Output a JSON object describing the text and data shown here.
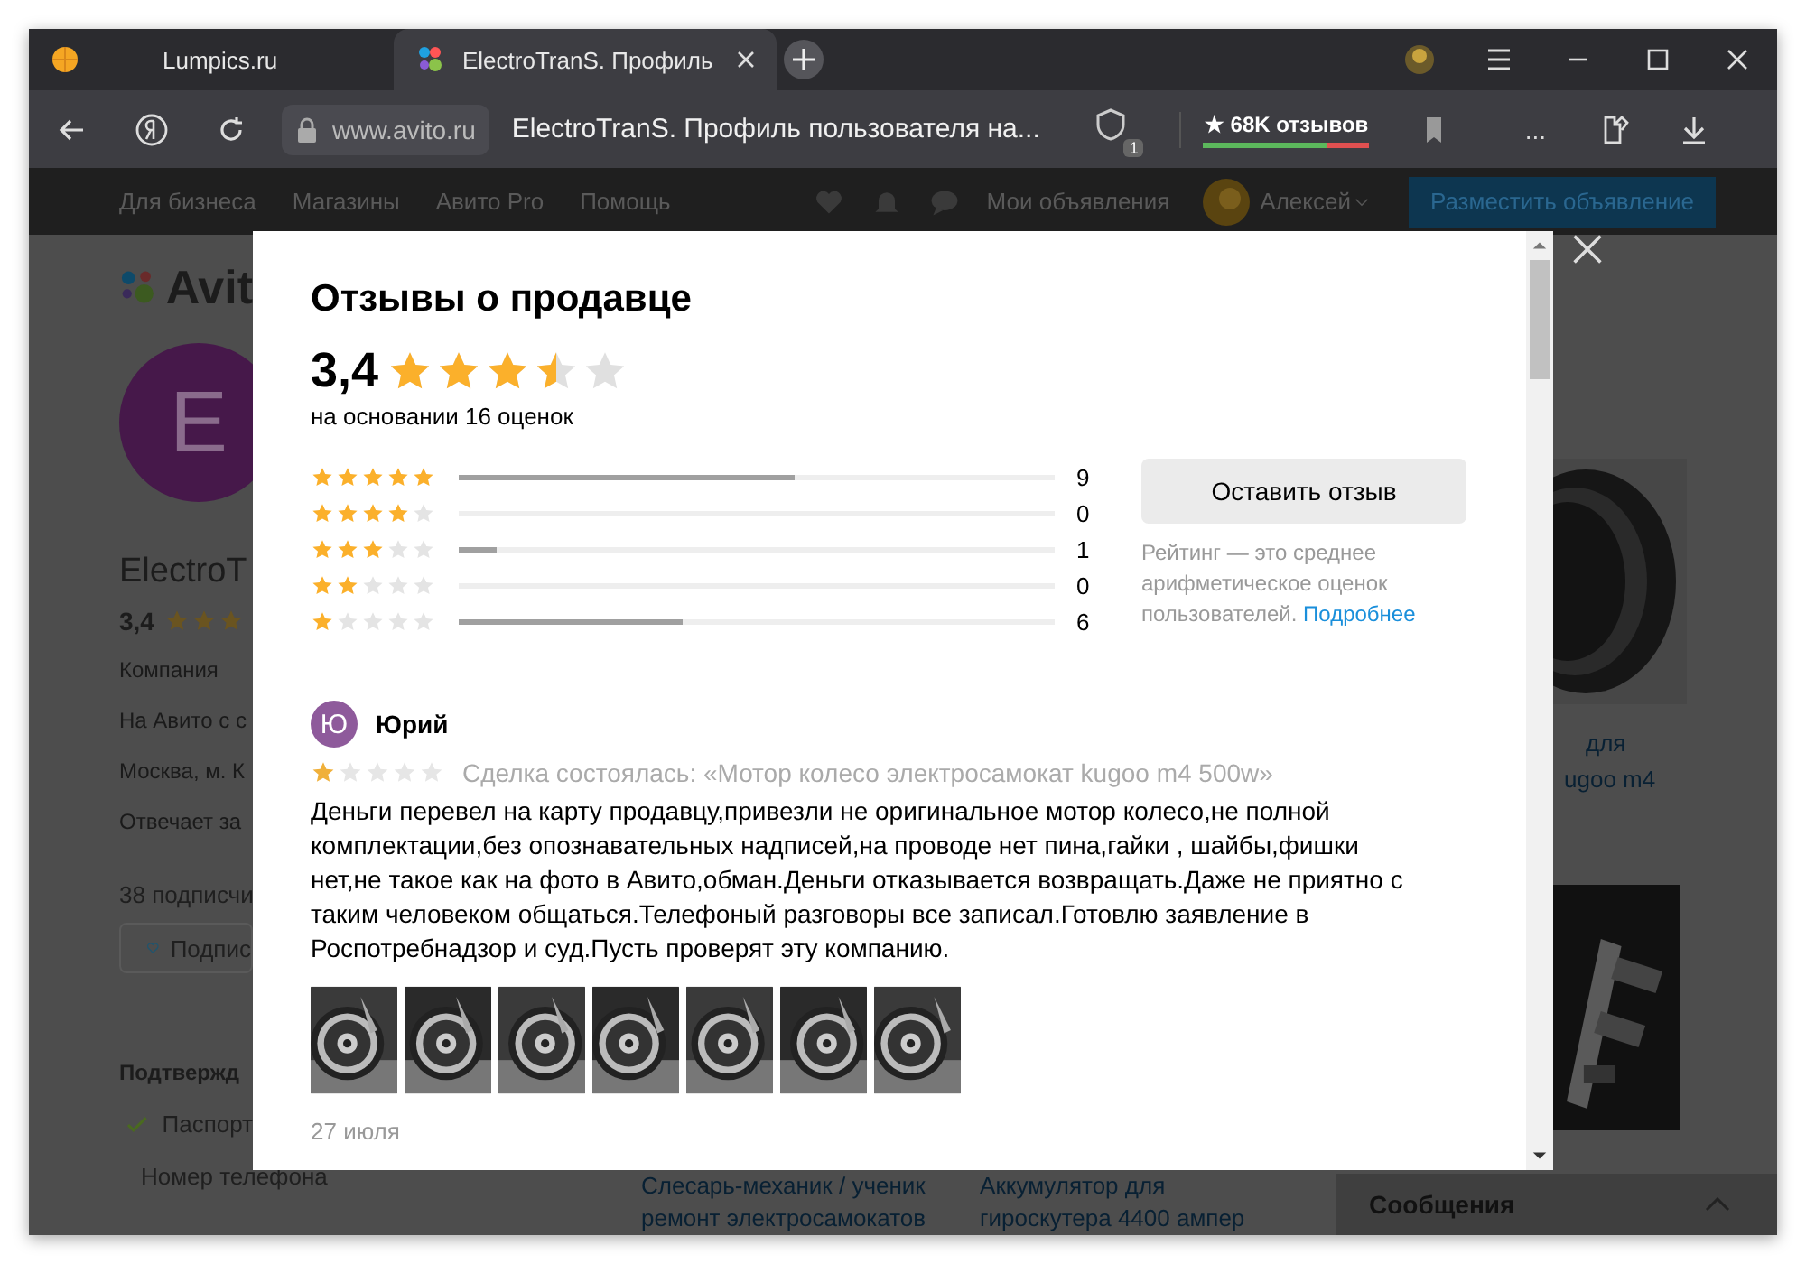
{
  "browser": {
    "tabs": [
      {
        "title": "Lumpics.ru",
        "selected": false
      },
      {
        "title": "ElectroTranS. Профиль",
        "selected": true
      }
    ],
    "address": {
      "domain": "www.avito.ru",
      "title": "ElectroTranS. Профиль пользователя на...",
      "extension_badge": "1",
      "reviews_badge": "★ 68K отзывов",
      "more": "..."
    }
  },
  "site_header": {
    "nav": [
      "Для бизнеса",
      "Магазины",
      "Авито Pro",
      "Помощь"
    ],
    "my_ads": "Мои объявления",
    "user": "Алексей",
    "post_button": "Разместить объявление"
  },
  "profile": {
    "logo": "Avit",
    "avatar_letter": "E",
    "name": "ElectroT",
    "rating": "3,4",
    "stars": 3,
    "details": [
      "Компания",
      "На Авито с с",
      "Москва, м. К",
      "Отвечает за"
    ],
    "subscribers": "38 подписчи",
    "subscribe_button": "Подпис",
    "verified_title": "Подтвержд",
    "verified": [
      "Паспорт",
      "Номер телефона"
    ]
  },
  "listings": {
    "side_caption": [
      "для",
      "ugoo m4"
    ],
    "bottom": [
      {
        "title_lines": [
          "Слесарь-механик / ученик",
          "ремонт электросамокатов"
        ]
      },
      {
        "title_lines": [
          "Аккумулятор для",
          "гироскутера 4400 ампер"
        ]
      }
    ]
  },
  "messages_bar": {
    "title": "Сообщения"
  },
  "modal": {
    "title": "Отзывы о продавце",
    "rating": "3,4",
    "stars": 3.5,
    "basis": "на основании 16 оценок",
    "breakdown": [
      {
        "stars": 5,
        "level": 0.5625,
        "count": "9"
      },
      {
        "stars": 4,
        "level": 0,
        "count": "0"
      },
      {
        "stars": 3,
        "level": 0.0625,
        "count": "1"
      },
      {
        "stars": 2,
        "level": 0,
        "count": "0"
      },
      {
        "stars": 1,
        "level": 0.375,
        "count": "6"
      }
    ],
    "leave_review_button": "Оставить отзыв",
    "note": "Рейтинг — это среднее арифметическое оценок пользователей.",
    "note_link": "Подробнее",
    "reviews": [
      {
        "avatar_letter": "Ю",
        "author": "Юрий",
        "stars": 1,
        "deal": "Сделка состоялась: «Мотор колесо электросамокат kugoo m4 500w»",
        "text": "Деньги перевел на карту продавцу,привезли не оригинальное мотор колесо,не полной комплектации,без опознавательных надписей,на проводе нет пина,гайки , шайбы,фишки нет,не такое как на фото в Авито,обман.Деньги отказывается возвращать.Даже не приятно с таким человеком общаться.Телефоный разговоры все записал.Готовлю заявление в Роспотребнадзор и суд.Пусть проверят эту компанию.",
        "photos": [
          {
            "kind": "picture"
          },
          {
            "kind": "picture"
          },
          {
            "kind": "picture"
          },
          {
            "kind": "picture"
          },
          {
            "kind": "picture"
          },
          {
            "kind": "picture"
          },
          {
            "kind": "picture"
          }
        ],
        "date": "27 июля"
      }
    ]
  }
}
